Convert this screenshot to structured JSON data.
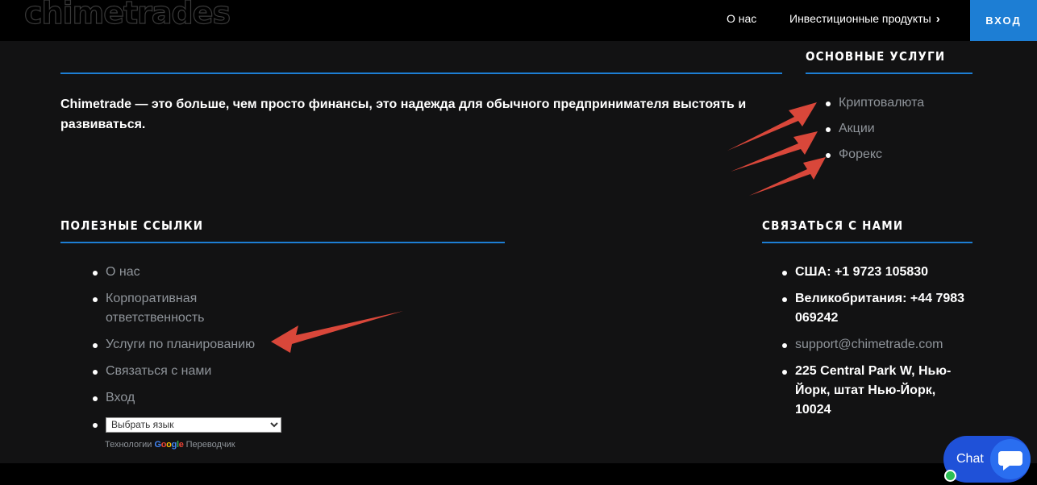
{
  "header": {
    "logo_text": "chimetrades",
    "nav": {
      "about": "О нас",
      "products": "Инвестиционные продукты"
    },
    "login_label": "Вход",
    "accent_color": "#1d7ed4"
  },
  "about": {
    "text": "Chimetrade — это больше, чем просто финансы, это надежда для обычного предпринимателя выстоять и развиваться."
  },
  "services": {
    "heading": "Основные услуги",
    "items": [
      "Криптовалюта",
      "Акции",
      "Форекс"
    ]
  },
  "useful_links": {
    "heading": "Полезные ссылки",
    "items": [
      "О нас",
      "Корпоративная ответственность",
      "Услуги по планированию",
      "Связаться с нами",
      "Вход"
    ],
    "language_select": "Выбрать язык",
    "powered_prefix": "Технологии",
    "powered_brand": "Google",
    "powered_suffix": "Переводчик"
  },
  "contact": {
    "heading": "Связаться с нами",
    "phone_us": "США: +1 9723 105830",
    "phone_uk": "Великобритания: +44 7983 069242",
    "email": "support@chimetrade.com",
    "address": "225 Central Park W, Нью-Йорк, штат Нью-Йорк, 10024"
  },
  "chat": {
    "label": "Chat"
  },
  "annotation_arrow_color": "#d9473a"
}
